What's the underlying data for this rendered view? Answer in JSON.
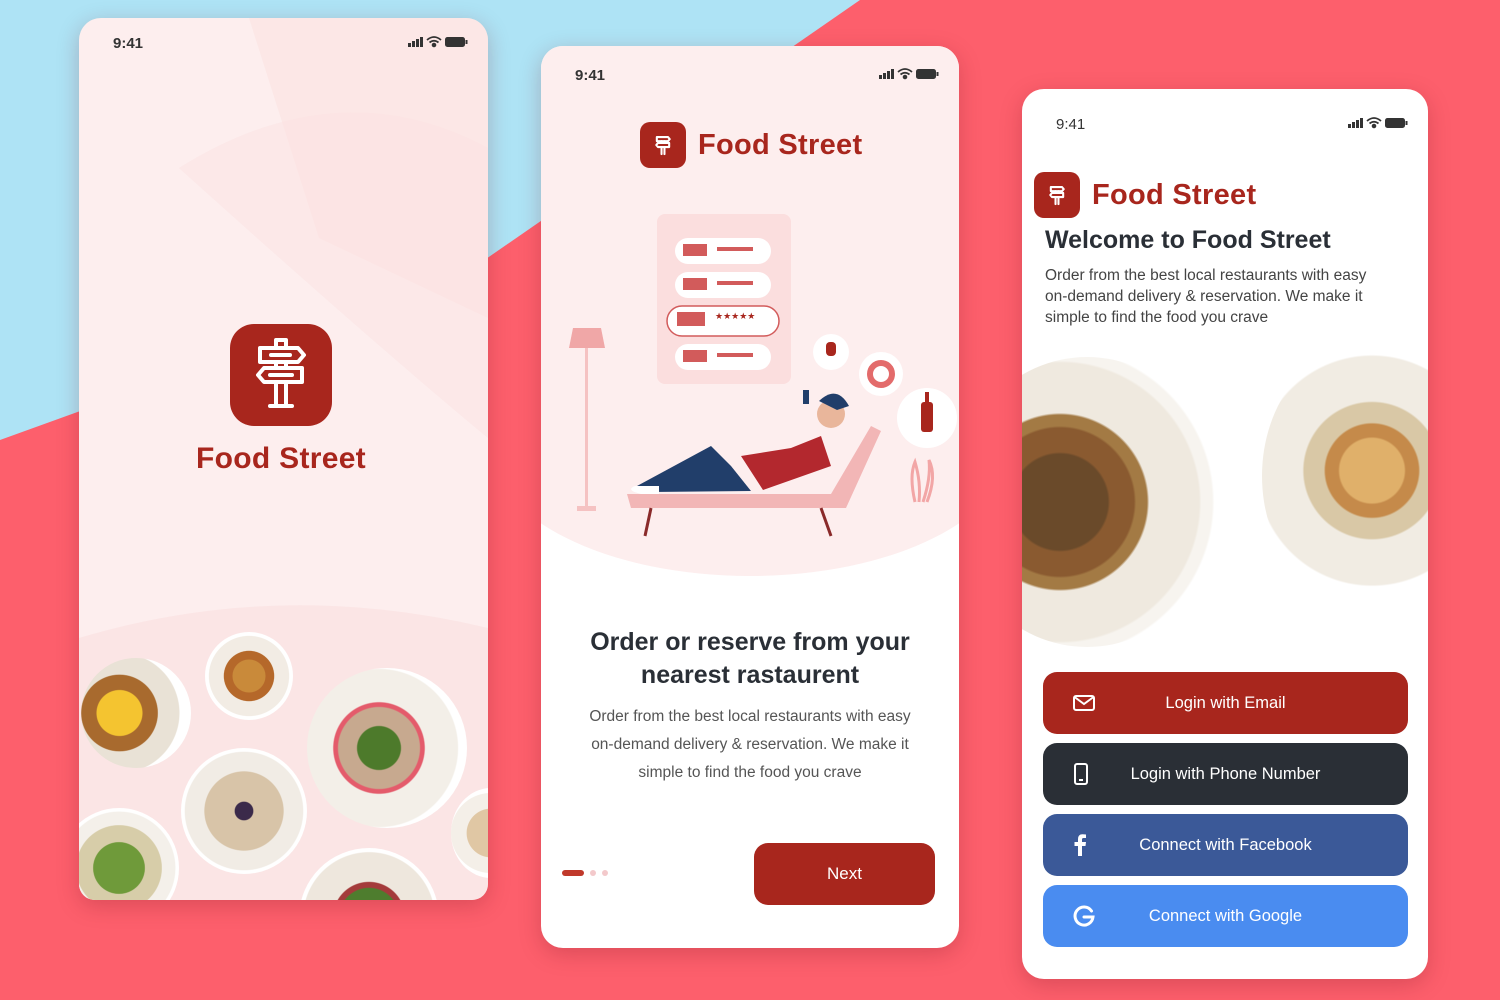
{
  "colors": {
    "background_red": "#fd5f6c",
    "background_blue": "#aee3f5",
    "brand": "#a8261d",
    "dark_button": "#2a2f36",
    "facebook": "#3b5998",
    "google": "#4a8cf0"
  },
  "status_bar": {
    "time": "9:41"
  },
  "splash": {
    "app_name": "Food Street",
    "logo_icon": "signpost-icon"
  },
  "onboarding": {
    "app_name": "Food Street",
    "title_line1": "Order or reserve  from your",
    "title_line2": "nearest rastaurent",
    "desc_line1": "Order from the best local restaurants with easy",
    "desc_line2": "on-demand delivery & reservation. We make it",
    "desc_line3": "simple to find the food you crave",
    "next_label": "Next",
    "page_count": 3,
    "active_page": 1
  },
  "login": {
    "app_name": "Food Street",
    "welcome_title": "Welcome to Food Street",
    "desc_line1": "Order from the best local restaurants with easy",
    "desc_line2": "on-demand delivery & reservation. We make it",
    "desc_line3": "simple to find the food you crave",
    "buttons": [
      {
        "label": "Login with Email",
        "icon": "mail-icon"
      },
      {
        "label": "Login with Phone Number",
        "icon": "phone-icon"
      },
      {
        "label": "Connect with Facebook",
        "icon": "facebook-icon"
      },
      {
        "label": "Connect with Google",
        "icon": "google-icon"
      }
    ]
  }
}
